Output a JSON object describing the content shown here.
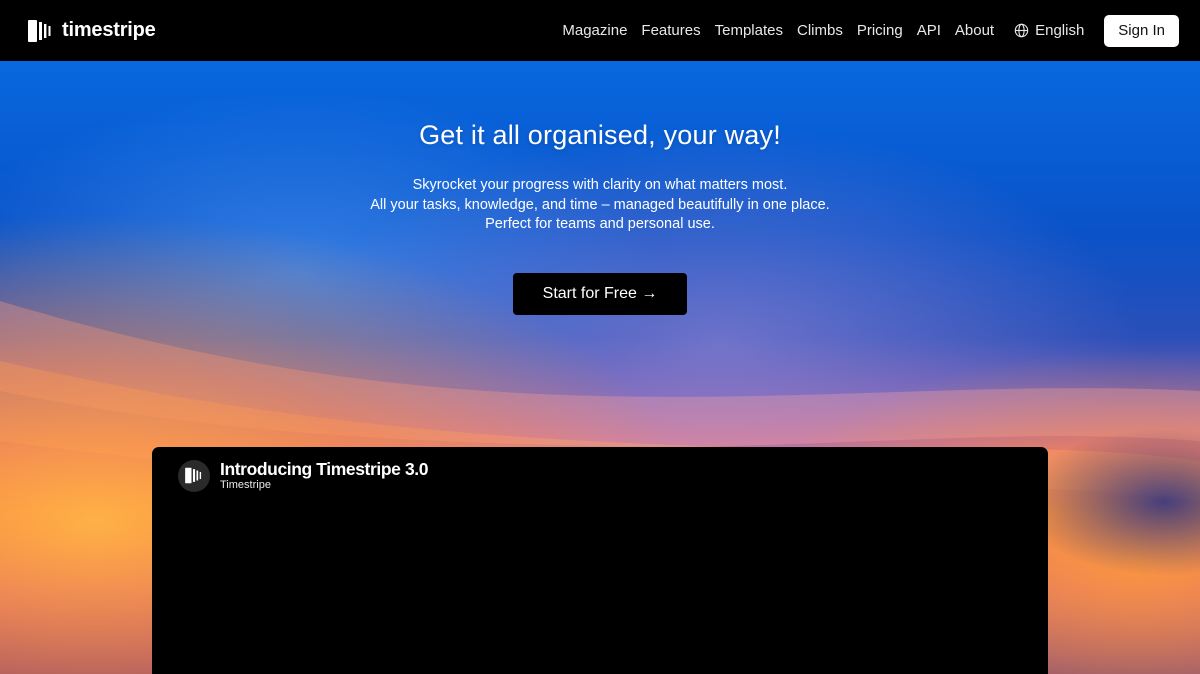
{
  "header": {
    "logo_text": "timestripe",
    "logo_icon": "timestripe-logo-icon",
    "nav": [
      {
        "label": "Magazine"
      },
      {
        "label": "Features"
      },
      {
        "label": "Templates"
      },
      {
        "label": "Climbs"
      },
      {
        "label": "Pricing"
      },
      {
        "label": "API"
      },
      {
        "label": "About"
      }
    ],
    "language": {
      "label": "English",
      "icon": "globe-icon"
    },
    "signin_label": "Sign In"
  },
  "hero": {
    "title": "Get it all organised, your way!",
    "subtitle_lines": [
      "Skyrocket your progress with clarity on what matters most.",
      "All your tasks, knowledge, and time – managed beautifully in one place. Perfect for teams and personal use."
    ],
    "cta_label": "Start for Free →"
  },
  "video": {
    "title": "Introducing Timestripe 3.0",
    "channel": "Timestripe",
    "avatar_icon": "timestripe-logo-icon"
  },
  "colors": {
    "header_bg": "#000000",
    "sky_top": "#0a5ed6",
    "sky_horizon": "#f07a3a",
    "cta_bg": "#000000",
    "signin_bg": "#ffffff"
  }
}
